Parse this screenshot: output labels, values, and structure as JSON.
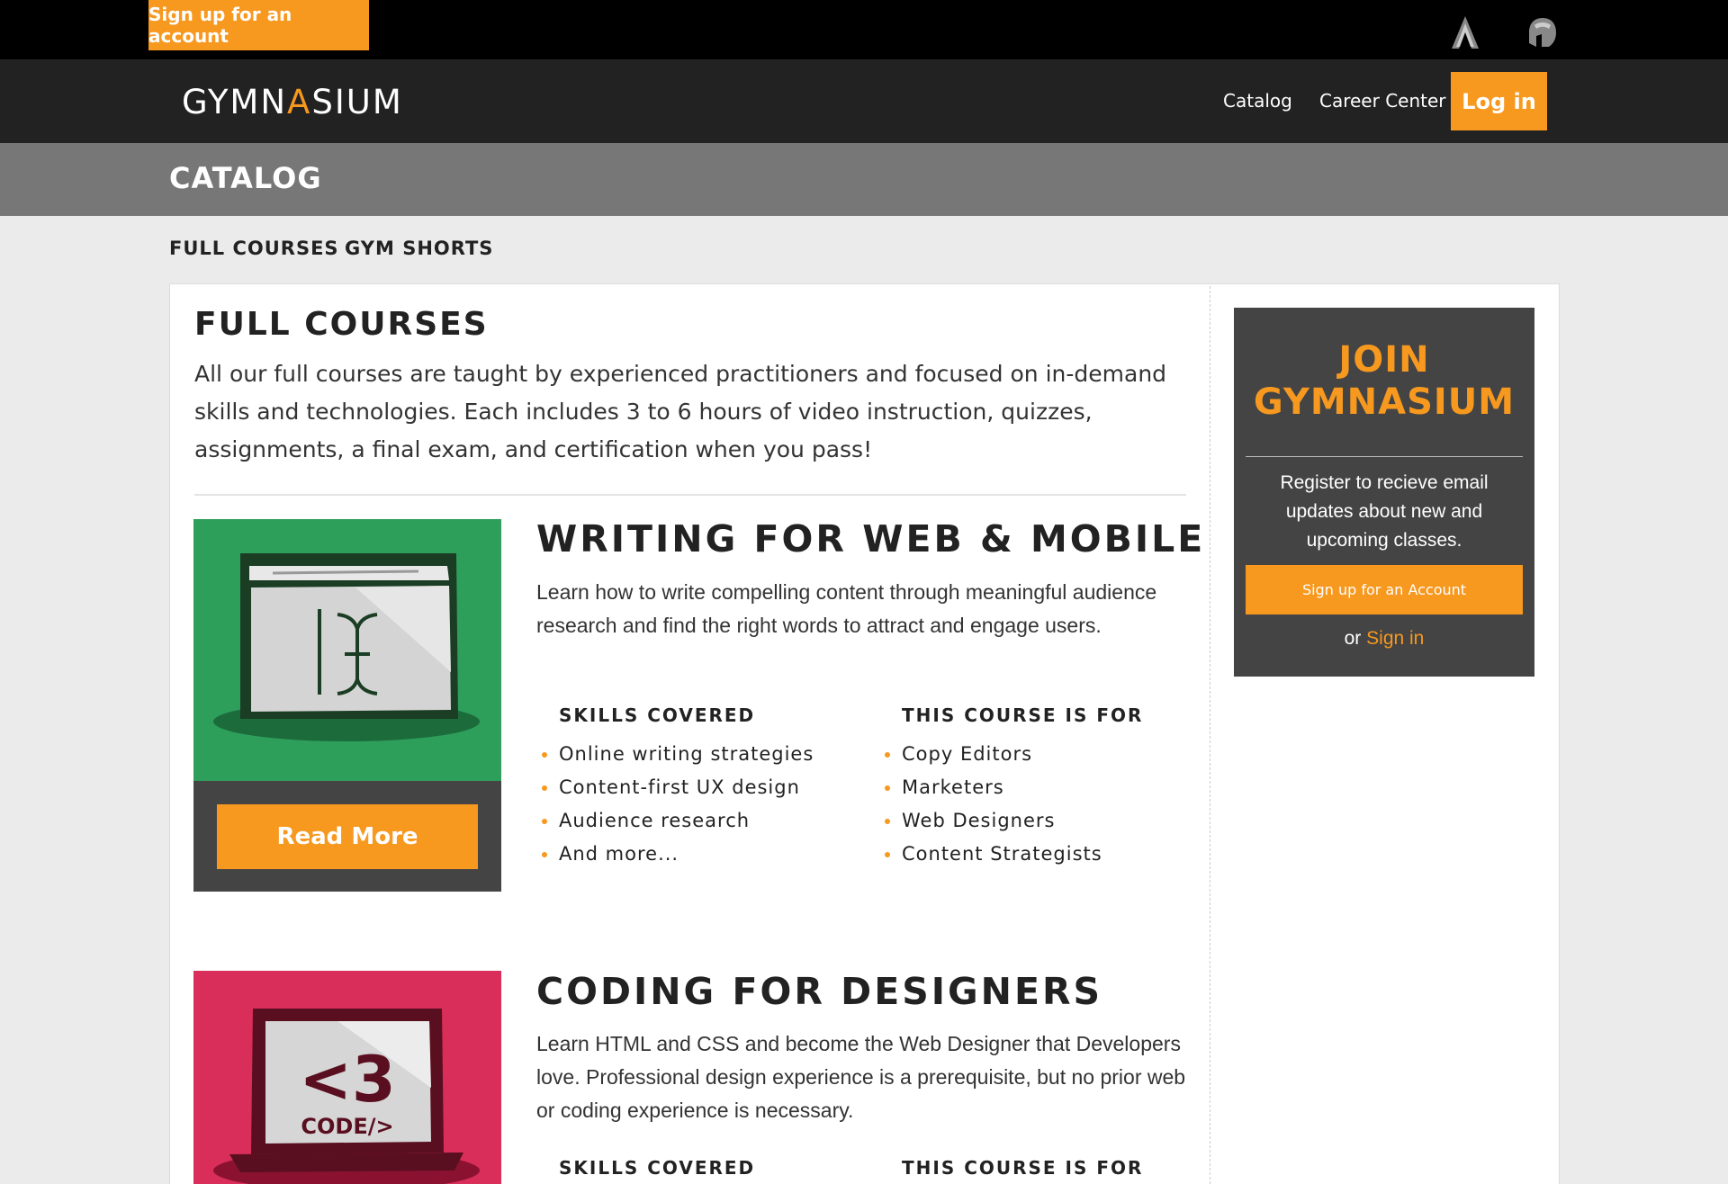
{
  "topbar": {
    "signup_label": "Sign up for an account",
    "icons": [
      "adobe-a-icon",
      "spartan-helmet-icon"
    ]
  },
  "navbar": {
    "logo": {
      "pre": "GYMN",
      "accent": "A",
      "post": "SIUM"
    },
    "links": [
      "Catalog",
      "Career Center"
    ],
    "login_label": "Log in"
  },
  "page": {
    "title": "CATALOG",
    "tabs": [
      "FULL COURSES",
      "GYM SHORTS"
    ]
  },
  "section": {
    "title": "FULL COURSES",
    "description": "All our full courses are taught by experienced practitioners and focused on in-demand skills and technologies. Each includes 3 to 6 hours of video instruction, quizzes, assignments, a final exam, and certification when you pass!"
  },
  "courses": [
    {
      "title": "WRITING FOR WEB & MOBILE",
      "description": "Learn how to write compelling content through meaningful audience research and find the right words to attract and engage users.",
      "skills_heading": "SKILLS COVERED",
      "skills": [
        "Online writing strategies",
        "Content-first UX design",
        "Audience research",
        "And more..."
      ],
      "for_heading": "THIS COURSE IS FOR",
      "audience": [
        "Copy Editors",
        "Marketers",
        "Web Designers",
        "Content Strategists"
      ],
      "read_more_label": "Read More",
      "image_color": "#2e9e5b",
      "image_icon": "text-cursor-window-icon"
    },
    {
      "title": "CODING FOR DESIGNERS",
      "description": "Learn HTML and CSS and become the Web Designer that Developers love. Professional design experience is a prerequisite, but no prior web or coding experience is necessary.",
      "skills_heading": "SKILLS COVERED",
      "for_heading": "THIS COURSE IS FOR",
      "image_color": "#d92d5a",
      "image_text_big": "<3",
      "image_text_small": "CODE/>",
      "image_icon": "laptop-heart-code-icon"
    }
  ],
  "join": {
    "title_line1": "JOIN",
    "title_line2": "GYMNASIUM",
    "text": "Register to recieve email updates about new and upcoming classes.",
    "button_label": "Sign up for an Account",
    "or_text": "or",
    "signin_label": "Sign in"
  },
  "colors": {
    "accent": "#f7981f",
    "dark": "#222222",
    "band": "#777777",
    "panel_dark": "#444444"
  }
}
